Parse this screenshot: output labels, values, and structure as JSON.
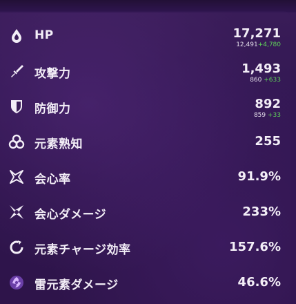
{
  "colors": {
    "background": "#2a1240",
    "text": "#f3eef7",
    "bonus": "#5fd35a"
  },
  "stats": [
    {
      "label": "HP",
      "value": "17,271",
      "base": "12,491",
      "bonus": "+4,780",
      "icon": "hp-drop-icon"
    },
    {
      "label": "攻撃力",
      "value": "1,493",
      "base": "860",
      "bonus": "+633",
      "icon": "sword-icon"
    },
    {
      "label": "防御力",
      "value": "892",
      "base": "859",
      "bonus": "+33",
      "icon": "shield-icon"
    },
    {
      "label": "元素熟知",
      "value": "255",
      "icon": "elemental-mastery-icon"
    },
    {
      "label": "会心率",
      "value": "91.9%",
      "icon": "crit-rate-icon"
    },
    {
      "label": "会心ダメージ",
      "value": "233%",
      "icon": "crit-damage-icon"
    },
    {
      "label": "元素チャージ効率",
      "value": "157.6%",
      "icon": "energy-recharge-icon"
    },
    {
      "label": "雷元素ダメージ",
      "value": "46.6%",
      "icon": "electro-damage-icon"
    }
  ]
}
